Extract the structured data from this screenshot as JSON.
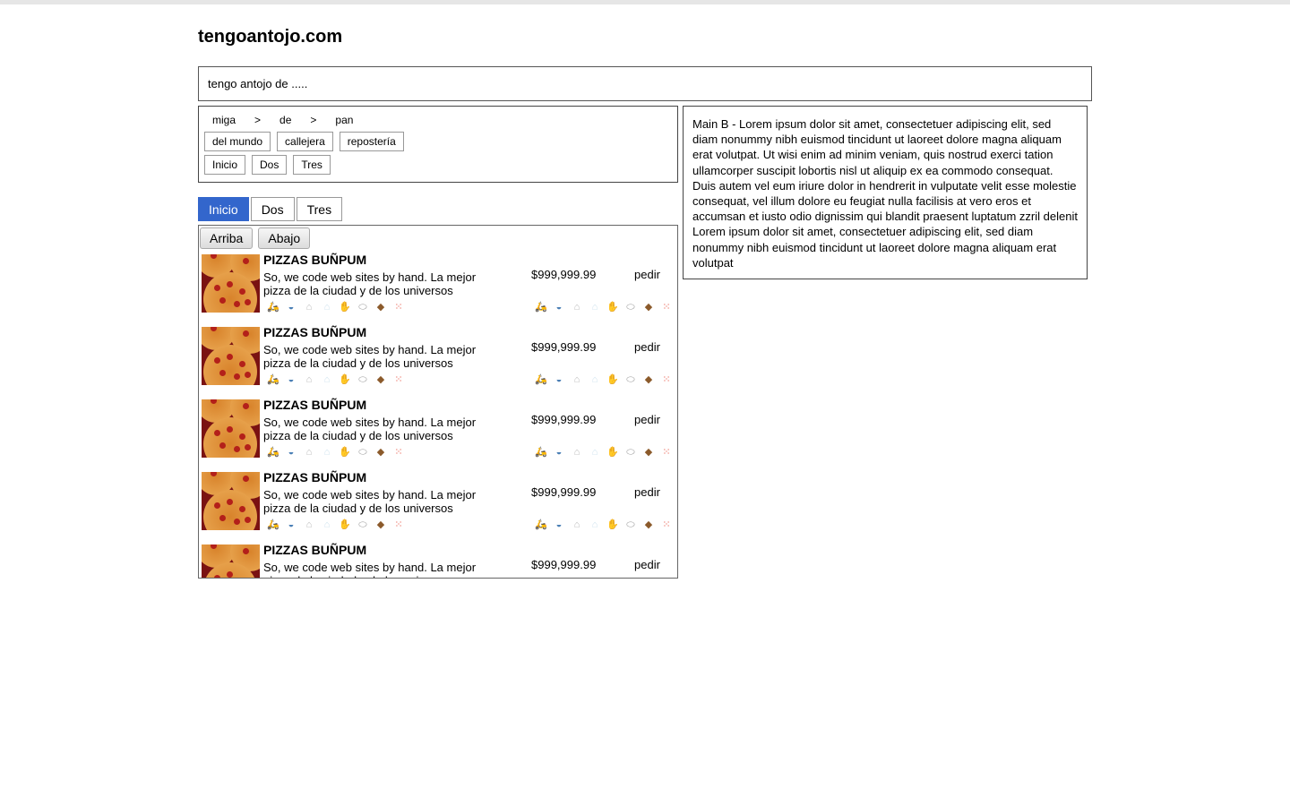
{
  "site": {
    "title": "tengoantojo.com"
  },
  "search": {
    "text": "tengo antojo de ....."
  },
  "breadcrumb": {
    "items": [
      "miga",
      ">",
      "de",
      ">",
      "pan"
    ]
  },
  "categories": [
    "del mundo",
    "callejera",
    "repostería"
  ],
  "nav_buttons": [
    "Inicio",
    "Dos",
    "Tres"
  ],
  "tabs": [
    {
      "label": "Inicio",
      "active": true
    },
    {
      "label": "Dos",
      "active": false
    },
    {
      "label": "Tres",
      "active": false
    }
  ],
  "scroll_buttons": {
    "up": "Arriba",
    "down": "Abajo"
  },
  "side_text": "Main B - Lorem ipsum dolor sit amet, consectetuer adipiscing elit, sed diam nonummy nibh euismod tincidunt ut laoreet dolore magna aliquam erat volutpat. Ut wisi enim ad minim veniam, quis nostrud exerci tation ullamcorper suscipit lobortis nisl ut aliquip ex ea commodo consequat. Duis autem vel eum iriure dolor in hendrerit in vulputate velit esse molestie consequat, vel illum dolore eu feugiat nulla facilisis at vero eros et accumsan et iusto odio dignissim qui blandit praesent luptatum zzril delenit Lorem ipsum dolor sit amet, consectetuer adipiscing elit, sed diam nonummy nibh euismod tincidunt ut laoreet dolore magna aliquam erat volutpat",
  "items": [
    {
      "name": "PIZZAS BUÑPUM",
      "desc": "So, we code web sites by hand. La mejor pizza de la ciudad y de los universos",
      "price": "$999,999.99",
      "order": "pedir"
    },
    {
      "name": "PIZZAS BUÑPUM",
      "desc": "So, we code web sites by hand. La mejor pizza de la ciudad y de los universos",
      "price": "$999,999.99",
      "order": "pedir"
    },
    {
      "name": "PIZZAS BUÑPUM",
      "desc": "So, we code web sites by hand. La mejor pizza de la ciudad y de los universos",
      "price": "$999,999.99",
      "order": "pedir"
    },
    {
      "name": "PIZZAS BUÑPUM",
      "desc": "So, we code web sites by hand. La mejor pizza de la ciudad y de los universos",
      "price": "$999,999.99",
      "order": "pedir"
    },
    {
      "name": "PIZZAS BUÑPUM",
      "desc": "So, we code web sites by hand. La mejor pizza de la ciudad y de los universos",
      "price": "$999,999.99",
      "order": "pedir"
    }
  ],
  "feature_icons": [
    {
      "name": "scooter-icon",
      "glyph": "🛵",
      "color": "#c0392b"
    },
    {
      "name": "pot-icon",
      "glyph": "◒",
      "color": "#4a7fb5"
    },
    {
      "name": "chef-hat-icon",
      "glyph": "⌂",
      "color": "#bbbbbb"
    },
    {
      "name": "shirt-icon",
      "glyph": "⌂",
      "color": "#cfe3ee"
    },
    {
      "name": "hand-icon",
      "glyph": "✋",
      "color": "#e0a088"
    },
    {
      "name": "plate-icon",
      "glyph": "⬭",
      "color": "#9a9a9a"
    },
    {
      "name": "bread-icon",
      "glyph": "◆",
      "color": "#8b5a2b"
    },
    {
      "name": "dots-icon",
      "glyph": "⁙",
      "color": "#e74c3c"
    }
  ]
}
